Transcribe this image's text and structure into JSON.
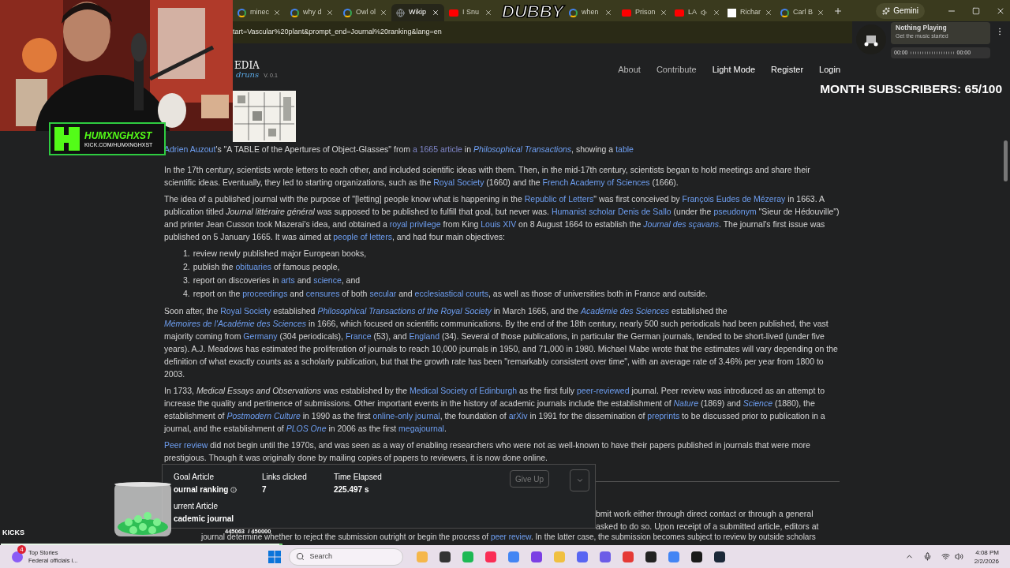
{
  "browser": {
    "tabs": [
      {
        "label": "minec",
        "selected": false,
        "kind": "google",
        "audio": false
      },
      {
        "label": "why d",
        "selected": false,
        "kind": "google",
        "audio": false
      },
      {
        "label": "Owl ol",
        "selected": false,
        "kind": "google",
        "audio": false
      },
      {
        "label": "Wikip",
        "selected": true,
        "kind": "globe",
        "audio": false
      },
      {
        "label": "I Snu",
        "selected": false,
        "kind": "youtube",
        "audio": false
      },
      {
        "label": "when",
        "selected": false,
        "kind": "google",
        "audio": false
      },
      {
        "label": "Prison",
        "selected": false,
        "kind": "youtube",
        "audio": false
      },
      {
        "label": "LA",
        "selected": false,
        "kind": "youtube",
        "audio": true
      },
      {
        "label": "Richar",
        "selected": false,
        "kind": "wiki",
        "audio": false
      },
      {
        "label": "Carl B",
        "selected": false,
        "kind": "google",
        "audio": false
      }
    ],
    "assistant_button": "Gemini",
    "address": "tart=Vascular%20plant&prompt_end=Journal%20ranking&lang=en"
  },
  "site": {
    "logo": "EDIA",
    "logo_sub": "druns",
    "version": "V. 0.1",
    "nav": [
      "About",
      "Contribute",
      "Light Mode",
      "Register",
      "Login"
    ]
  },
  "article": {
    "caption": [
      {
        "kind": "link",
        "text": "Adrien Auzout"
      },
      {
        "kind": "text",
        "text": "'s \"A TABLE of the Apertures of Object-Glasses\" from "
      },
      {
        "kind": "visited_link",
        "text": "a 1665 article"
      },
      {
        "kind": "text",
        "text": " in "
      },
      {
        "kind": "italic_link",
        "text": "Philosophical Transactions"
      },
      {
        "kind": "text",
        "text": ", showing a "
      },
      {
        "kind": "link",
        "text": "table"
      }
    ],
    "blocks": [
      {
        "kind": "paragraph",
        "segments": [
          {
            "kind": "text",
            "text": "In the 17th century, scientists wrote letters to each other, and included scientific ideas with them. Then, in the mid-17th century, scientists began to hold meetings and share their scientific ideas. Eventually, they led to starting organizations, such as the "
          },
          {
            "kind": "link",
            "text": "Royal Society"
          },
          {
            "kind": "text",
            "text": " (1660) and the "
          },
          {
            "kind": "link",
            "text": "French Academy of Sciences"
          },
          {
            "kind": "text",
            "text": " (1666)."
          }
        ]
      },
      {
        "kind": "paragraph",
        "segments": [
          {
            "kind": "text",
            "text": "The idea of a published journal with the purpose of \"[letting] people know what is happening in the "
          },
          {
            "kind": "link",
            "text": "Republic of Letters"
          },
          {
            "kind": "text",
            "text": "\" was first conceived by "
          },
          {
            "kind": "link",
            "text": "François Eudes de Mézeray"
          },
          {
            "kind": "text",
            "text": " in 1663. A publication titled "
          },
          {
            "kind": "italic",
            "text": "Journal littéraire général"
          },
          {
            "kind": "text",
            "text": " was supposed to be published to fulfill that goal, but never was. "
          },
          {
            "kind": "link",
            "text": "Humanist scholar"
          },
          {
            "kind": "space"
          },
          {
            "kind": "link",
            "text": "Denis de Sallo"
          },
          {
            "kind": "text",
            "text": " (under the "
          },
          {
            "kind": "link",
            "text": "pseudonym"
          },
          {
            "kind": "text",
            "text": " \"Sieur de Hédouville\") and printer Jean Cusson took Mazerai's idea, and obtained a "
          },
          {
            "kind": "link",
            "text": "royal privilege"
          },
          {
            "kind": "text",
            "text": " from King "
          },
          {
            "kind": "link",
            "text": "Louis XIV"
          },
          {
            "kind": "text",
            "text": " on 8 August 1664 to establish the "
          },
          {
            "kind": "italic_link",
            "text": "Journal des sçavans"
          },
          {
            "kind": "text",
            "text": ". The journal's first issue was published on 5 January 1665. It was aimed at "
          },
          {
            "kind": "link",
            "text": "people of letters"
          },
          {
            "kind": "text",
            "text": ", and had four main objectives:"
          }
        ]
      },
      {
        "kind": "list",
        "items": [
          {
            "number": "1.",
            "segments": [
              {
                "kind": "text",
                "text": "review newly published major European books,"
              }
            ]
          },
          {
            "number": "2.",
            "segments": [
              {
                "kind": "text",
                "text": "publish the "
              },
              {
                "kind": "link",
                "text": "obituaries"
              },
              {
                "kind": "text",
                "text": " of famous people,"
              }
            ]
          },
          {
            "number": "3.",
            "segments": [
              {
                "kind": "text",
                "text": "report on discoveries in "
              },
              {
                "kind": "link",
                "text": "arts"
              },
              {
                "kind": "text",
                "text": " and "
              },
              {
                "kind": "link",
                "text": "science"
              },
              {
                "kind": "text",
                "text": ", and"
              }
            ]
          },
          {
            "number": "4.",
            "segments": [
              {
                "kind": "text",
                "text": "report on the "
              },
              {
                "kind": "link",
                "text": "proceedings"
              },
              {
                "kind": "text",
                "text": " and "
              },
              {
                "kind": "link",
                "text": "censures"
              },
              {
                "kind": "text",
                "text": " of both "
              },
              {
                "kind": "link",
                "text": "secular"
              },
              {
                "kind": "text",
                "text": " and "
              },
              {
                "kind": "link",
                "text": "ecclesiastical courts"
              },
              {
                "kind": "text",
                "text": ", as well as those of universities both in France and outside."
              }
            ]
          }
        ]
      },
      {
        "kind": "paragraph",
        "segments": [
          {
            "kind": "text",
            "text": "Soon after, the "
          },
          {
            "kind": "link",
            "text": "Royal Society"
          },
          {
            "kind": "text",
            "text": " established "
          },
          {
            "kind": "italic_link",
            "text": "Philosophical Transactions of the Royal Society"
          },
          {
            "kind": "text",
            "text": " in March 1665, and the "
          },
          {
            "kind": "italic_link",
            "text": "Académie des Sciences"
          },
          {
            "kind": "text",
            "text": " established the "
          },
          {
            "kind": "italic_link",
            "text": "Mémoires de l'Académie des Sciences"
          },
          {
            "kind": "text",
            "text": " in 1666, which focused on scientific communications. By the end of the 18th century, nearly 500 such periodicals had been published, the vast majority coming from "
          },
          {
            "kind": "link",
            "text": "Germany"
          },
          {
            "kind": "text",
            "text": " (304 periodicals), "
          },
          {
            "kind": "link",
            "text": "France"
          },
          {
            "kind": "text",
            "text": " (53), and "
          },
          {
            "kind": "link",
            "text": "England"
          },
          {
            "kind": "text",
            "text": " (34). Several of those publications, in particular the German journals, tended to be short-lived (under five years). A.J. Meadows has estimated the proliferation of journals to reach 10,000 journals in 1950, and 71,000 in 1980. Michael Mabe wrote that the estimates will vary depending on the definition of what exactly counts as a scholarly publication, but that the growth rate has been \"remarkably consistent over time\", with an average rate of 3.46% per year from 1800 to 2003."
          }
        ]
      },
      {
        "kind": "paragraph",
        "segments": [
          {
            "kind": "text",
            "text": "In 1733, "
          },
          {
            "kind": "italic",
            "text": "Medical Essays and Observations"
          },
          {
            "kind": "text",
            "text": " was established by the "
          },
          {
            "kind": "link",
            "text": "Medical Society of Edinburgh"
          },
          {
            "kind": "text",
            "text": " as the first fully "
          },
          {
            "kind": "link",
            "text": "peer-reviewed"
          },
          {
            "kind": "text",
            "text": " journal. Peer review was introduced as an attempt to increase the quality and pertinence of submissions. Other important events in the history of academic journals include the establishment of "
          },
          {
            "kind": "italic_link",
            "text": "Nature"
          },
          {
            "kind": "text",
            "text": " (1869) and "
          },
          {
            "kind": "italic_link",
            "text": "Science"
          },
          {
            "kind": "text",
            "text": " (1880), the establishment of "
          },
          {
            "kind": "italic_link",
            "text": "Postmodern Culture"
          },
          {
            "kind": "text",
            "text": " in 1990 as the first "
          },
          {
            "kind": "link",
            "text": "online-only journal"
          },
          {
            "kind": "text",
            "text": ", the foundation of "
          },
          {
            "kind": "link",
            "text": "arXiv"
          },
          {
            "kind": "text",
            "text": " in 1991 for the dissemination of "
          },
          {
            "kind": "link",
            "text": "preprints"
          },
          {
            "kind": "text",
            "text": " to be discussed prior to publication in a journal, and the establishment of "
          },
          {
            "kind": "italic_link",
            "text": "PLOS One"
          },
          {
            "kind": "text",
            "text": " in 2006 as the first "
          },
          {
            "kind": "link",
            "text": "megajournal"
          },
          {
            "kind": "text",
            "text": "."
          }
        ]
      },
      {
        "kind": "paragraph",
        "segments": [
          {
            "kind": "link",
            "text": "Peer review"
          },
          {
            "kind": "text",
            "text": " did not begin until the 1970s, and was seen as a way of enabling researchers who were not as well-known to have their papers published in journals that were more prestigious. Though it was originally done by mailing copies of papers to reviewers, it is now done online."
          }
        ]
      }
    ],
    "partial_lines": [
      [
        {
          "kind": "text",
          "text": "bmit work either through direct contact or through a general"
        }
      ],
      [
        {
          "kind": "text",
          "text": "asked to do so. Upon receipt of a submitted article, editors at"
        }
      ],
      [
        {
          "kind": "text",
          "text": "journal determine whether to reject the submission outright or begin the process of "
        },
        {
          "kind": "link",
          "text": "peer review"
        },
        {
          "kind": "text",
          "text": ". In the latter case, the submission becomes subject to review by outside scholars"
        }
      ]
    ]
  },
  "game_panel": {
    "goal_label": "Goal Article",
    "goal": "ournal ranking",
    "links_label": "Links clicked",
    "links": "7",
    "time_label": "Time Elapsed",
    "time": "225.497 s",
    "current_label": "urrent Article",
    "current": "cademic journal",
    "give_up": "Give Up",
    "give_up_disabled": true
  },
  "stream": {
    "badge_name": "HUMXNGHXST",
    "badge_url": "KICK.COM/HUMXNGHXST",
    "logo": "DUBBY",
    "music_title": "Nothing Playing",
    "music_sub": "Get the music started",
    "music_start": "00:00",
    "music_end": "00:00",
    "subscribers": "MONTH SUBSCRIBERS: 65/100",
    "kicks_label": "KICKS",
    "kicks_count": "445063  / 450000",
    "kicks": {
      "level": 0.989
    }
  },
  "taskbar": {
    "news_title": "Top Stories",
    "news_text": "Federal officials i...",
    "news_badge": "4",
    "search": "Search",
    "time": "4:08 PM",
    "date": "2/2/2026"
  }
}
